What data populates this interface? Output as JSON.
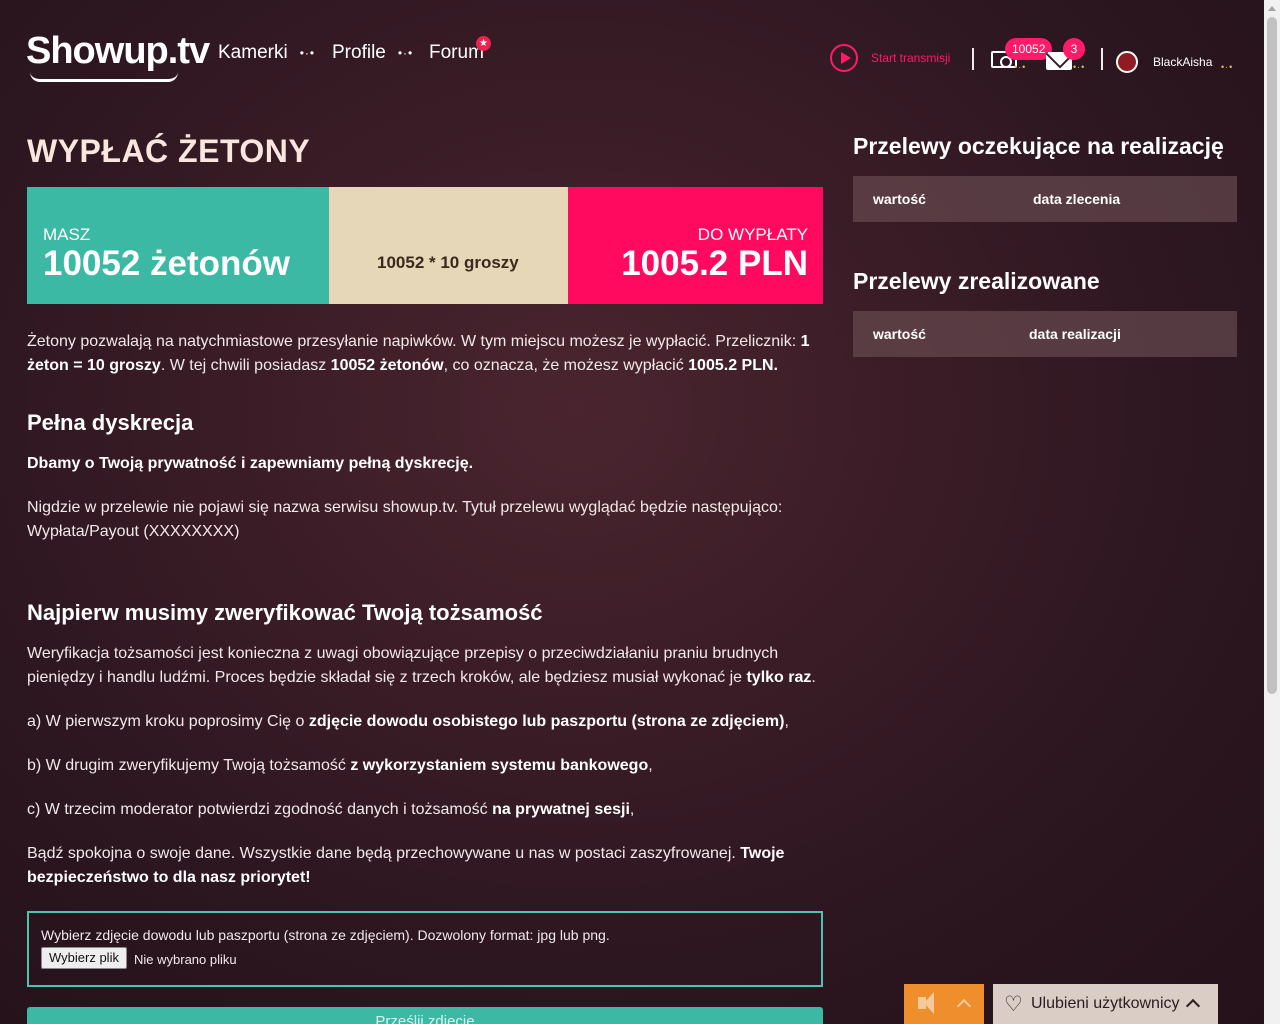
{
  "header": {
    "logo": "Showup.tv",
    "nav": [
      {
        "label": "Kamerki"
      },
      {
        "label": "Profile"
      },
      {
        "label": "Forum"
      }
    ],
    "start_label": "Start transmisji",
    "tokens_badge": "10052",
    "messages_badge": "3",
    "username": "BlackAisha"
  },
  "main": {
    "title": "WYPŁAĆ ŻETONY",
    "summary": {
      "have_label": "MASZ",
      "have_value": "10052 żetonów",
      "calc": "10052 * 10 groszy",
      "payout_label": "DO WYPŁATY",
      "payout_value": "1005.2 PLN"
    },
    "intro": {
      "p1": "Żetony pozwalają na natychmiastowe przesyłanie napiwków. W tym miejscu możesz je wypłacić.  Przelicznik: ",
      "b1": "1 żeton = 10 groszy",
      "p2": ". W tej chwili posiadasz ",
      "b2": "10052 żetonów",
      "p3": ", co oznacza, że możesz wypłacić ",
      "b3": "1005.2 PLN."
    },
    "discretion": {
      "heading": "Pełna dyskrecja",
      "bold": "Dbamy o Twoją prywatność i zapewniamy pełną dyskrecję.",
      "text": "Nigdzie w przelewie nie pojawi się nazwa serwisu showup.tv. Tytuł przelewu wyglądać będzie następująco: Wypłata/Payout (XXXXXXXX)"
    },
    "verify": {
      "heading": "Najpierw musimy zweryfikować Twoją tożsamość",
      "p1": "Weryfikacja tożsamości jest konieczna z uwagi obowiązujące przepisy o przeciwdziałaniu praniu brudnych pieniędzy i handlu ludźmi.  Proces będzie składał się z trzech kroków, ale będziesz musiał wykonać je ",
      "p1b": "tylko raz",
      "p1e": ".",
      "a_pre": "a) W pierwszym kroku poprosimy Cię o ",
      "a_b": "zdjęcie dowodu osobistego lub paszportu (strona ze zdjęciem)",
      "a_post": ",",
      "b_pre": "b) W drugim zweryfikujemy Twoją tożsamość ",
      "b_b": "z wykorzystaniem systemu bankowego",
      "b_post": ",",
      "c_pre": "c) W trzecim moderator potwierdzi zgodność danych i tożsamość ",
      "c_b": "na prywatnej sesji",
      "c_post": ",",
      "final_pre": "Bądź spokojna o swoje dane. Wszystkie dane będą przechowywane u nas w postaci zaszyfrowanej. ",
      "final_b": "Twoje bezpieczeństwo to dla nasz priorytet!"
    },
    "upload": {
      "hint": "Wybierz zdjęcie dowodu lub paszportu (strona ze zdjęciem). Dozwolony format: jpg lub png.",
      "button": "Wybierz plik",
      "none": "Nie wybrano pliku"
    },
    "submit": "Prześlij zdjęcie"
  },
  "right": {
    "pending_title": "Przelewy oczekujące na realizację",
    "pending_cols": [
      "wartość",
      "data zlecenia"
    ],
    "done_title": "Przelewy zrealizowane",
    "done_cols": [
      "wartość",
      "data realizacji"
    ]
  },
  "bottom": {
    "favorites": "Ulubieni użytkownicy"
  },
  "colors": {
    "teal": "#3cb9a5",
    "beige": "#e6d7b9",
    "pink": "#ff0a5e",
    "accent_orange": "#ef8e2d"
  }
}
